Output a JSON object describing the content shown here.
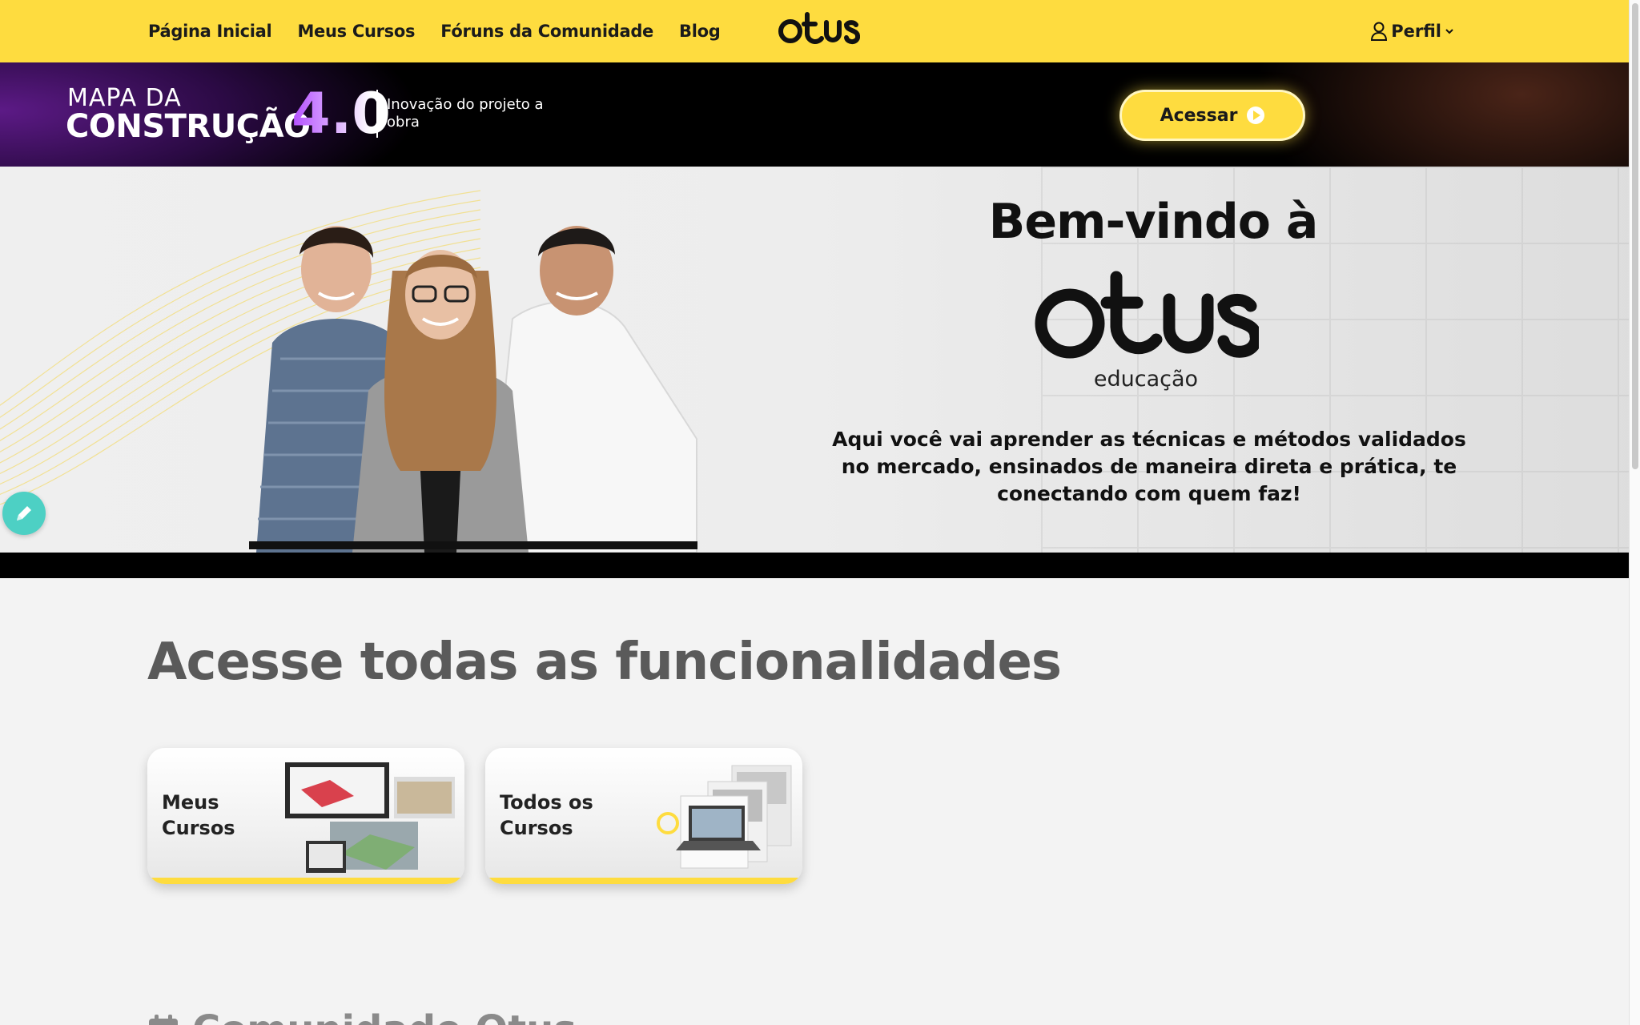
{
  "nav": {
    "links": [
      "Página Inicial",
      "Meus Cursos",
      "Fóruns da Comunidade",
      "Blog"
    ],
    "brand": "Otus",
    "profile_label": "Perfil",
    "bg_color": "#fedc3f"
  },
  "promo": {
    "line1": "MAPA DA",
    "line2": "CONSTRUÇÃO",
    "version": "4.0",
    "tagline": "Inovação do projeto a obra",
    "button_label": "Acessar"
  },
  "hero": {
    "title": "Bem-vindo à",
    "brand_sub": "educação",
    "description": "Aqui você vai aprender as técnicas e métodos validados no mercado, ensinados de maneira direta e prática, te conectando com quem faz!"
  },
  "features": {
    "title": "Acesse todas as funcionalidades",
    "cards": [
      {
        "label": "Meus Cursos"
      },
      {
        "label": "Todos os Cursos"
      }
    ]
  },
  "community": {
    "title": "Comunidade Otus",
    "icon": "calendar-icon"
  }
}
